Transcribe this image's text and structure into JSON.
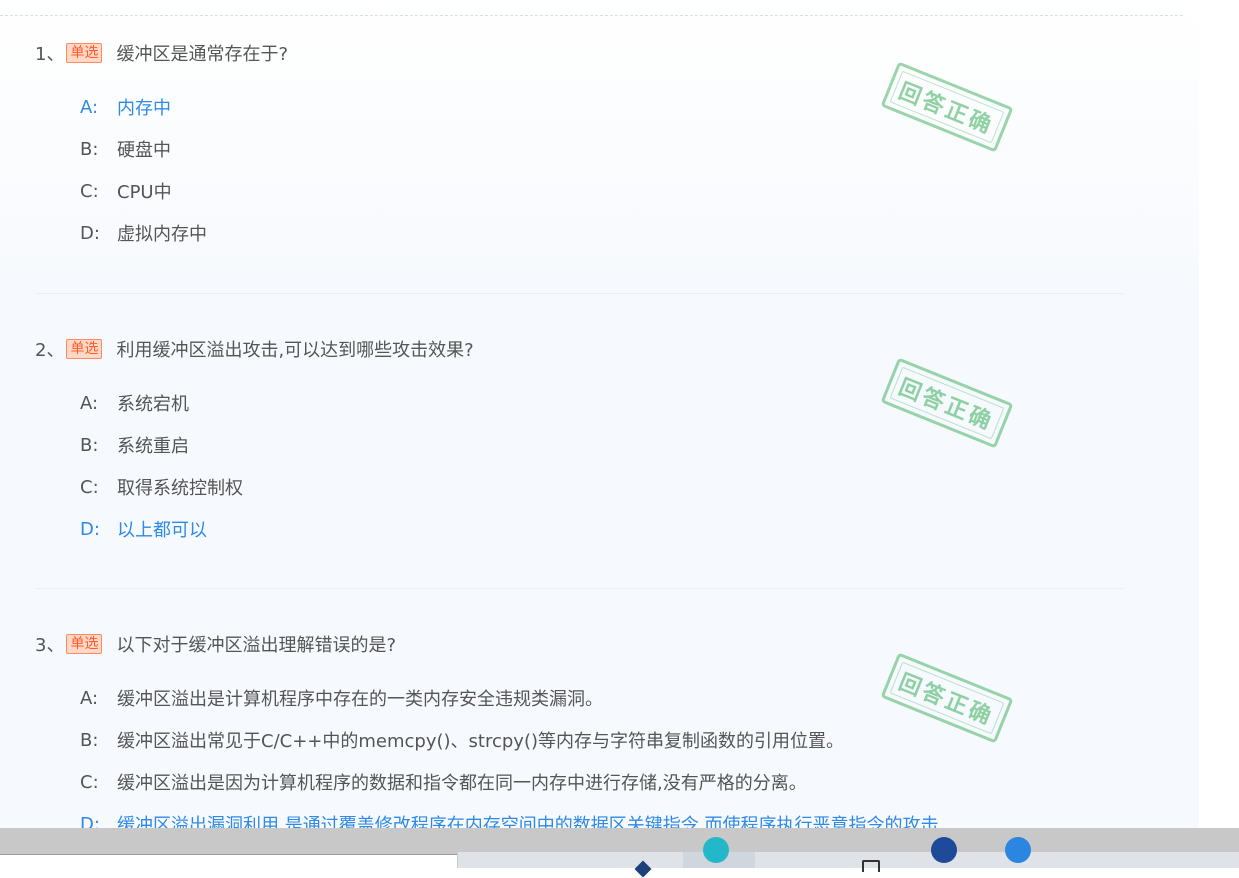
{
  "questions": [
    {
      "number": "1、",
      "type": "单选",
      "text": "缓冲区是通常存在于?",
      "stamp": "回答正确",
      "options": [
        {
          "letter": "A:",
          "text": "内存中",
          "correct": true
        },
        {
          "letter": "B:",
          "text": "硬盘中",
          "correct": false
        },
        {
          "letter": "C:",
          "text": "CPU中",
          "correct": false
        },
        {
          "letter": "D:",
          "text": "虚拟内存中",
          "correct": false
        }
      ]
    },
    {
      "number": "2、",
      "type": "单选",
      "text": "利用缓冲区溢出攻击,可以达到哪些攻击效果?",
      "stamp": "回答正确",
      "options": [
        {
          "letter": "A:",
          "text": "系统宕机",
          "correct": false
        },
        {
          "letter": "B:",
          "text": "系统重启",
          "correct": false
        },
        {
          "letter": "C:",
          "text": "取得系统控制权",
          "correct": false
        },
        {
          "letter": "D:",
          "text": "以上都可以",
          "correct": true
        }
      ]
    },
    {
      "number": "3、",
      "type": "单选",
      "text": "以下对于缓冲区溢出理解错误的是?",
      "stamp": "回答正确",
      "options": [
        {
          "letter": "A:",
          "text": "缓冲区溢出是计算机程序中存在的一类内存安全违规类漏洞。",
          "correct": false
        },
        {
          "letter": "B:",
          "text": "缓冲区溢出常见于C/C++中的memcpy()、strcpy()等内存与字符串复制函数的引用位置。",
          "correct": false
        },
        {
          "letter": "C:",
          "text": "缓冲区溢出是因为计算机程序的数据和指令都在同一内存中进行存储,没有严格的分离。",
          "correct": false
        },
        {
          "letter": "D:",
          "text": "缓冲区溢出漏洞利用,是通过覆盖修改程序在内存空间中的数据区关键指令,而使程序执行恶意指令的攻击",
          "correct": true
        }
      ]
    }
  ],
  "colors": {
    "text": "#555555",
    "correct_option": "#2f8ae5",
    "tag_text": "#ff5a2c",
    "tag_bg": "#ffd9c6",
    "stamp": "#48b464"
  }
}
